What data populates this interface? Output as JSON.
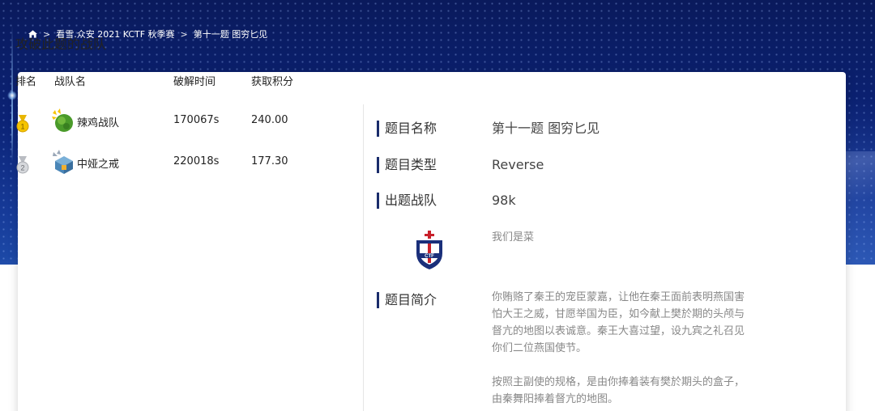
{
  "breadcrumb": {
    "home_icon": "home-icon",
    "separator": ">",
    "items": [
      "看雪.众安 2021 KCTF 秋季赛",
      "第十一题 图穷匕见"
    ]
  },
  "left_panel": {
    "title": "攻破此题的战队",
    "headers": {
      "rank": "排名",
      "name": "战队名",
      "time": "破解时间",
      "score": "获取积分"
    },
    "rows": [
      {
        "rank_icon": "gold-medal-icon",
        "rank_number": "1",
        "avatar_icon": "green-planet-avatar-icon",
        "name": "辣鸡战队",
        "time": "170067s",
        "score": "240.00"
      },
      {
        "rank_icon": "silver-medal-icon",
        "rank_number": "2",
        "avatar_icon": "treasure-box-avatar-icon",
        "name": "中娅之戒",
        "time": "220018s",
        "score": "177.30"
      }
    ]
  },
  "right_panel": {
    "name_label": "题目名称",
    "name_value": "第十一题 图穷匕见",
    "type_label": "题目类型",
    "type_value": "Reverse",
    "team_label": "出题战队",
    "team_value": "98k",
    "team_desc": "我们是菜",
    "team_logo": "ctf-shield-logo-icon",
    "intro_label": "题目简介",
    "intro_paragraphs": [
      "你贿赂了秦王的宠臣蒙嘉，让他在秦王面前表明燕国害怕大王之威，甘愿举国为臣，如今献上樊於期的头颅与督亢的地图以表诚意。秦王大喜过望，设九宾之礼召见你们二位燕国使节。",
      "按照主副使的规格，是由你捧着装有樊於期头的盒子，由秦舞阳捧着督亢的地图。"
    ]
  },
  "colors": {
    "accent_bar": "#1a2c6b",
    "hero_top": "#0a1a5c",
    "muted_text": "#888888"
  }
}
